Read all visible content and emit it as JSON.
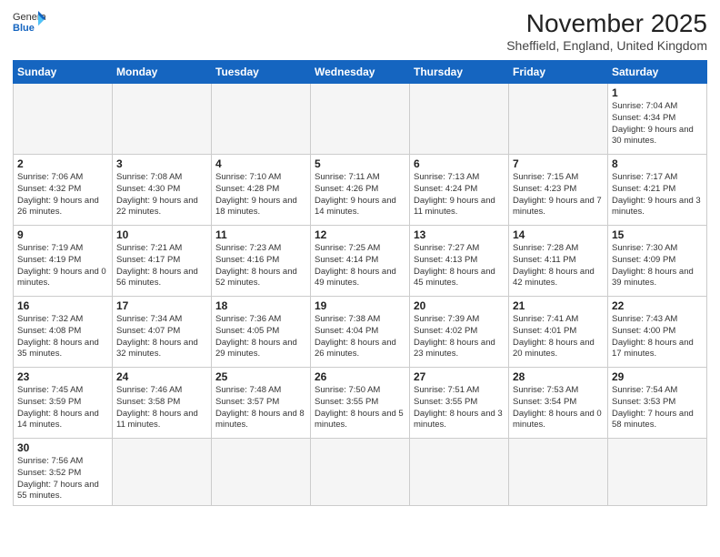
{
  "header": {
    "logo_general": "General",
    "logo_blue": "Blue",
    "month_title": "November 2025",
    "subtitle": "Sheffield, England, United Kingdom"
  },
  "days_of_week": [
    "Sunday",
    "Monday",
    "Tuesday",
    "Wednesday",
    "Thursday",
    "Friday",
    "Saturday"
  ],
  "weeks": [
    [
      {
        "day": "",
        "info": ""
      },
      {
        "day": "",
        "info": ""
      },
      {
        "day": "",
        "info": ""
      },
      {
        "day": "",
        "info": ""
      },
      {
        "day": "",
        "info": ""
      },
      {
        "day": "",
        "info": ""
      },
      {
        "day": "1",
        "info": "Sunrise: 7:04 AM\nSunset: 4:34 PM\nDaylight: 9 hours and 30 minutes."
      }
    ],
    [
      {
        "day": "2",
        "info": "Sunrise: 7:06 AM\nSunset: 4:32 PM\nDaylight: 9 hours and 26 minutes."
      },
      {
        "day": "3",
        "info": "Sunrise: 7:08 AM\nSunset: 4:30 PM\nDaylight: 9 hours and 22 minutes."
      },
      {
        "day": "4",
        "info": "Sunrise: 7:10 AM\nSunset: 4:28 PM\nDaylight: 9 hours and 18 minutes."
      },
      {
        "day": "5",
        "info": "Sunrise: 7:11 AM\nSunset: 4:26 PM\nDaylight: 9 hours and 14 minutes."
      },
      {
        "day": "6",
        "info": "Sunrise: 7:13 AM\nSunset: 4:24 PM\nDaylight: 9 hours and 11 minutes."
      },
      {
        "day": "7",
        "info": "Sunrise: 7:15 AM\nSunset: 4:23 PM\nDaylight: 9 hours and 7 minutes."
      },
      {
        "day": "8",
        "info": "Sunrise: 7:17 AM\nSunset: 4:21 PM\nDaylight: 9 hours and 3 minutes."
      }
    ],
    [
      {
        "day": "9",
        "info": "Sunrise: 7:19 AM\nSunset: 4:19 PM\nDaylight: 9 hours and 0 minutes."
      },
      {
        "day": "10",
        "info": "Sunrise: 7:21 AM\nSunset: 4:17 PM\nDaylight: 8 hours and 56 minutes."
      },
      {
        "day": "11",
        "info": "Sunrise: 7:23 AM\nSunset: 4:16 PM\nDaylight: 8 hours and 52 minutes."
      },
      {
        "day": "12",
        "info": "Sunrise: 7:25 AM\nSunset: 4:14 PM\nDaylight: 8 hours and 49 minutes."
      },
      {
        "day": "13",
        "info": "Sunrise: 7:27 AM\nSunset: 4:13 PM\nDaylight: 8 hours and 45 minutes."
      },
      {
        "day": "14",
        "info": "Sunrise: 7:28 AM\nSunset: 4:11 PM\nDaylight: 8 hours and 42 minutes."
      },
      {
        "day": "15",
        "info": "Sunrise: 7:30 AM\nSunset: 4:09 PM\nDaylight: 8 hours and 39 minutes."
      }
    ],
    [
      {
        "day": "16",
        "info": "Sunrise: 7:32 AM\nSunset: 4:08 PM\nDaylight: 8 hours and 35 minutes."
      },
      {
        "day": "17",
        "info": "Sunrise: 7:34 AM\nSunset: 4:07 PM\nDaylight: 8 hours and 32 minutes."
      },
      {
        "day": "18",
        "info": "Sunrise: 7:36 AM\nSunset: 4:05 PM\nDaylight: 8 hours and 29 minutes."
      },
      {
        "day": "19",
        "info": "Sunrise: 7:38 AM\nSunset: 4:04 PM\nDaylight: 8 hours and 26 minutes."
      },
      {
        "day": "20",
        "info": "Sunrise: 7:39 AM\nSunset: 4:02 PM\nDaylight: 8 hours and 23 minutes."
      },
      {
        "day": "21",
        "info": "Sunrise: 7:41 AM\nSunset: 4:01 PM\nDaylight: 8 hours and 20 minutes."
      },
      {
        "day": "22",
        "info": "Sunrise: 7:43 AM\nSunset: 4:00 PM\nDaylight: 8 hours and 17 minutes."
      }
    ],
    [
      {
        "day": "23",
        "info": "Sunrise: 7:45 AM\nSunset: 3:59 PM\nDaylight: 8 hours and 14 minutes."
      },
      {
        "day": "24",
        "info": "Sunrise: 7:46 AM\nSunset: 3:58 PM\nDaylight: 8 hours and 11 minutes."
      },
      {
        "day": "25",
        "info": "Sunrise: 7:48 AM\nSunset: 3:57 PM\nDaylight: 8 hours and 8 minutes."
      },
      {
        "day": "26",
        "info": "Sunrise: 7:50 AM\nSunset: 3:55 PM\nDaylight: 8 hours and 5 minutes."
      },
      {
        "day": "27",
        "info": "Sunrise: 7:51 AM\nSunset: 3:55 PM\nDaylight: 8 hours and 3 minutes."
      },
      {
        "day": "28",
        "info": "Sunrise: 7:53 AM\nSunset: 3:54 PM\nDaylight: 8 hours and 0 minutes."
      },
      {
        "day": "29",
        "info": "Sunrise: 7:54 AM\nSunset: 3:53 PM\nDaylight: 7 hours and 58 minutes."
      }
    ],
    [
      {
        "day": "30",
        "info": "Sunrise: 7:56 AM\nSunset: 3:52 PM\nDaylight: 7 hours and 55 minutes."
      },
      {
        "day": "",
        "info": ""
      },
      {
        "day": "",
        "info": ""
      },
      {
        "day": "",
        "info": ""
      },
      {
        "day": "",
        "info": ""
      },
      {
        "day": "",
        "info": ""
      },
      {
        "day": "",
        "info": ""
      }
    ]
  ]
}
